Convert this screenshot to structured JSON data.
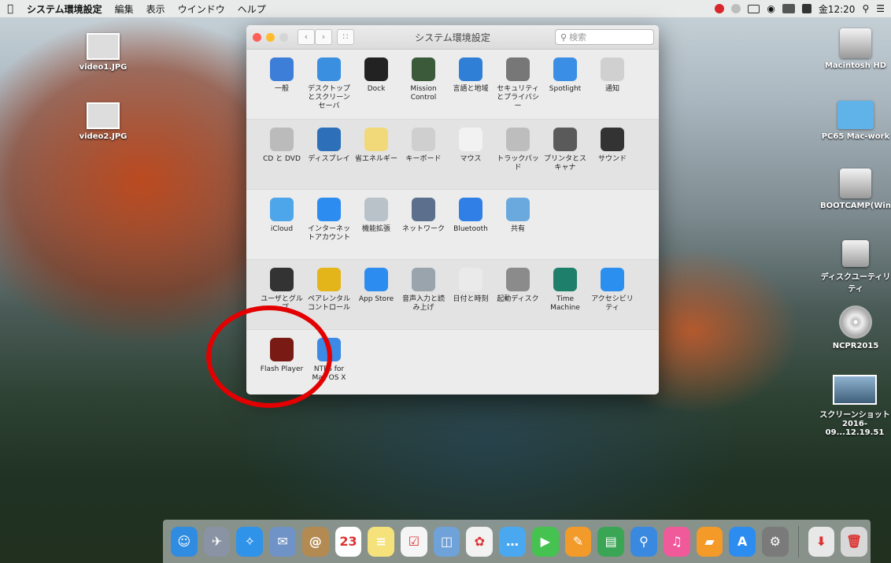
{
  "menubar": {
    "apple": "",
    "items": [
      "システム環境設定",
      "編集",
      "表示",
      "ウインドウ",
      "ヘルプ"
    ],
    "clock": "金12:20"
  },
  "desktop_left": [
    {
      "label": "video1.JPG"
    },
    {
      "label": "video2.JPG"
    }
  ],
  "desktop_right": [
    {
      "label": "Macintosh HD"
    },
    {
      "label": "PC65 Mac-work"
    },
    {
      "label": "BOOTCAMP(Windows)"
    },
    {
      "label": "ディスクユーティリティ"
    },
    {
      "label": "NCPR2015"
    },
    {
      "label": "スクリーンショット 2016-09...12.19.51"
    }
  ],
  "window": {
    "title": "システム環境設定",
    "search_placeholder": "検索",
    "rows": [
      [
        {
          "label": "一般",
          "icon": "general-icon",
          "color": "#3d7fd8"
        },
        {
          "label": "デスクトップとスクリーンセーバ",
          "icon": "desktop-icon",
          "color": "#3a8fe0"
        },
        {
          "label": "Dock",
          "icon": "dock-icon",
          "color": "#222222"
        },
        {
          "label": "Mission Control",
          "icon": "mission-control-icon",
          "color": "#3a5a3a"
        },
        {
          "label": "言語と地域",
          "icon": "language-icon",
          "color": "#2f7fd6"
        },
        {
          "label": "セキュリティとプライバシー",
          "icon": "security-icon",
          "color": "#777777"
        },
        {
          "label": "Spotlight",
          "icon": "spotlight-icon",
          "color": "#3b8ee5"
        },
        {
          "label": "通知",
          "icon": "notifications-icon",
          "color": "#d0d0d0"
        }
      ],
      [
        {
          "label": "CD と DVD",
          "icon": "cd-dvd-icon",
          "color": "#bbbbbb"
        },
        {
          "label": "ディスプレイ",
          "icon": "display-icon",
          "color": "#2d6fb8"
        },
        {
          "label": "省エネルギー",
          "icon": "energy-icon",
          "color": "#f1d97a"
        },
        {
          "label": "キーボード",
          "icon": "keyboard-icon",
          "color": "#cfcfcf"
        },
        {
          "label": "マウス",
          "icon": "mouse-icon",
          "color": "#f2f2f2"
        },
        {
          "label": "トラックパッド",
          "icon": "trackpad-icon",
          "color": "#bdbdbd"
        },
        {
          "label": "プリンタとスキャナ",
          "icon": "printer-icon",
          "color": "#5a5a5a"
        },
        {
          "label": "サウンド",
          "icon": "sound-icon",
          "color": "#333333"
        }
      ],
      [
        {
          "label": "iCloud",
          "icon": "icloud-icon",
          "color": "#4ea6ea"
        },
        {
          "label": "インターネットアカウント",
          "icon": "internet-accounts-icon",
          "color": "#2d8cf0"
        },
        {
          "label": "機能拡張",
          "icon": "extensions-icon",
          "color": "#b8c2c8"
        },
        {
          "label": "ネットワーク",
          "icon": "network-icon",
          "color": "#5c6f8c"
        },
        {
          "label": "Bluetooth",
          "icon": "bluetooth-icon",
          "color": "#2f7fe6"
        },
        {
          "label": "共有",
          "icon": "sharing-icon",
          "color": "#6aa9de"
        }
      ],
      [
        {
          "label": "ユーザとグループ",
          "icon": "users-icon",
          "color": "#333333"
        },
        {
          "label": "ペアレンタルコントロール",
          "icon": "parental-icon",
          "color": "#e3b51b"
        },
        {
          "label": "App Store",
          "icon": "app-store-icon",
          "color": "#2d8cf0"
        },
        {
          "label": "音声入力と読み上げ",
          "icon": "dictation-icon",
          "color": "#9aa4ad"
        },
        {
          "label": "日付と時刻",
          "icon": "date-time-icon",
          "color": "#eaeaea"
        },
        {
          "label": "起動ディスク",
          "icon": "startup-disk-icon",
          "color": "#8b8b8b"
        },
        {
          "label": "Time Machine",
          "icon": "time-machine-icon",
          "color": "#1e7f6a"
        },
        {
          "label": "アクセシビリティ",
          "icon": "accessibility-icon",
          "color": "#2b8ff0"
        }
      ],
      [
        {
          "label": "Flash Player",
          "icon": "flash-player-icon",
          "color": "#7a1a14"
        },
        {
          "label": "NTFS for Mac OS X",
          "icon": "ntfs-icon",
          "color": "#3b8ae6"
        }
      ]
    ]
  },
  "dock": [
    {
      "name": "finder",
      "color": "#2f8ce0",
      "glyph": "☺"
    },
    {
      "name": "launchpad",
      "color": "#8a93a3",
      "glyph": "✈"
    },
    {
      "name": "safari",
      "color": "#2f93ea",
      "glyph": "✧"
    },
    {
      "name": "mail",
      "color": "#6f93c6",
      "glyph": "✉"
    },
    {
      "name": "contacts",
      "color": "#b38a52",
      "glyph": "@"
    },
    {
      "name": "calendar",
      "color": "#ffffff",
      "glyph": "23"
    },
    {
      "name": "notes",
      "color": "#f5e27a",
      "glyph": "≡"
    },
    {
      "name": "reminders",
      "color": "#f5f5f5",
      "glyph": "☑"
    },
    {
      "name": "preview",
      "color": "#6fa2d8",
      "glyph": "◫"
    },
    {
      "name": "photos",
      "color": "#f2f2f2",
      "glyph": "✿"
    },
    {
      "name": "messages",
      "color": "#4aa8f0",
      "glyph": "…"
    },
    {
      "name": "facetime",
      "color": "#46c251",
      "glyph": "▶"
    },
    {
      "name": "pages",
      "color": "#f29a2a",
      "glyph": "✎"
    },
    {
      "name": "numbers",
      "color": "#3aa655",
      "glyph": "▤"
    },
    {
      "name": "keynote",
      "color": "#3a89e0",
      "glyph": "⚲"
    },
    {
      "name": "itunes",
      "color": "#f05a9a",
      "glyph": "♫"
    },
    {
      "name": "ibooks",
      "color": "#f39a28",
      "glyph": "▰"
    },
    {
      "name": "app-store",
      "color": "#2d8cf0",
      "glyph": "A"
    },
    {
      "name": "system-preferences",
      "color": "#7a7a7a",
      "glyph": "⚙"
    },
    {
      "name": "downloads",
      "color": "#e8e8e8",
      "glyph": "⬇"
    },
    {
      "name": "trash",
      "color": "#d8d8d8",
      "glyph": "🗑"
    }
  ]
}
